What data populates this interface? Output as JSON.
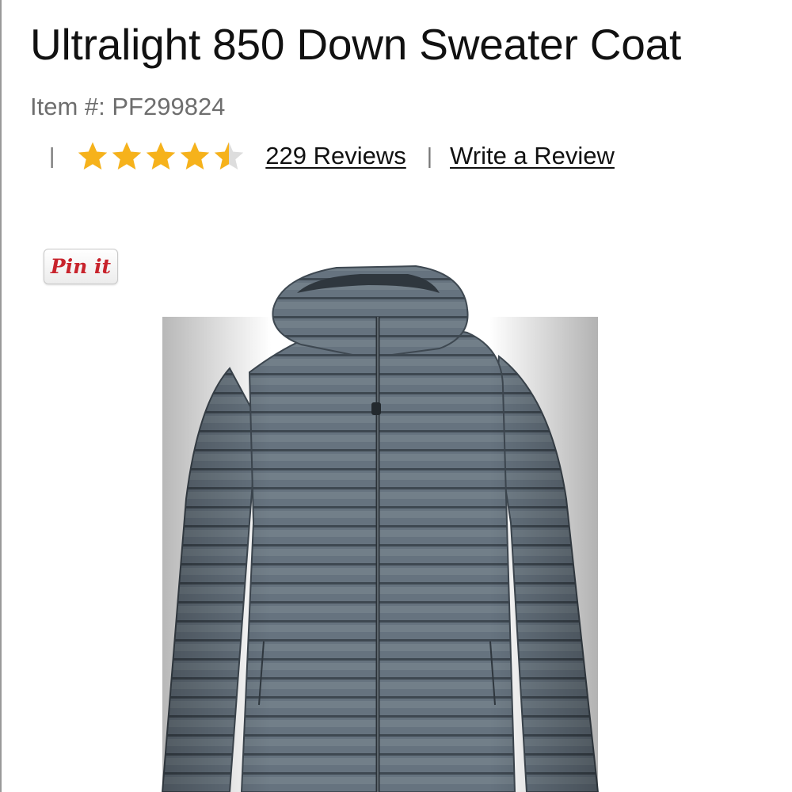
{
  "product": {
    "title": "Ultralight 850 Down Sweater Coat",
    "item_number": "Item #: PF299824"
  },
  "rating": {
    "value": 4.5,
    "max": 5,
    "star_color": "#f6b21b",
    "empty_star_color": "#dddddd",
    "reviews_link": "229 Reviews",
    "separator": "|",
    "write_review_link": "Write a Review"
  },
  "pin_button": {
    "label": "Pin it",
    "color": "#c8232c"
  },
  "image": {
    "subject": "coat-image",
    "fabric_color": "#5d6b77"
  }
}
